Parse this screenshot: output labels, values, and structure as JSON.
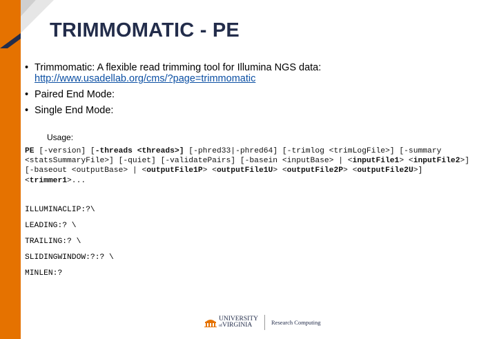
{
  "slide": {
    "title": "TRIMMOMATIC - PE",
    "bullets": [
      {
        "text": "Trimmomatic: A flexible read trimming tool for Illumina NGS data:",
        "link": "http://www.usadellab.org/cms/?page=trimmomatic"
      },
      {
        "text": "Paired End Mode:"
      },
      {
        "text": "Single End Mode:"
      }
    ],
    "bullet_symbol": "•",
    "usage_label": "Usage:",
    "code": {
      "t1": "PE",
      "t2": " [-version] [",
      "t3": "-threads <threads>]",
      "t4": " [-phred33|-phred64] [-trimlog <trimLogFile>] [-summary <statsSummaryFile>] [-quiet] [-validatePairs] [-basein <inputBase> | <",
      "t5": "inputFile1",
      "t6": "> <",
      "t7": "inputFile2",
      "t8": ">] [-baseout <outputBase> | <",
      "t9": "outputFile1P",
      "t10": "> <",
      "t11": "outputFile1U",
      "t12": "> <",
      "t13": "outputFile2P",
      "t14": "> <",
      "t15": "outputFile2U",
      "t16": ">] <",
      "t17": "trimmer1",
      "t18": ">..."
    },
    "steps": [
      "ILLUMINACLIP:?\\",
      "LEADING:? \\",
      "TRAILING:? \\",
      "SLIDINGWINDOW:?:? \\",
      "MINLEN:?"
    ]
  },
  "footer": {
    "logo_line1": "UNIVERSITY",
    "logo_line2": "VIRGINIA",
    "logo_of": "of",
    "department": "Research Computing"
  },
  "colors": {
    "accent": "#e57200",
    "title": "#232d4b",
    "link": "#0b4fa3"
  }
}
